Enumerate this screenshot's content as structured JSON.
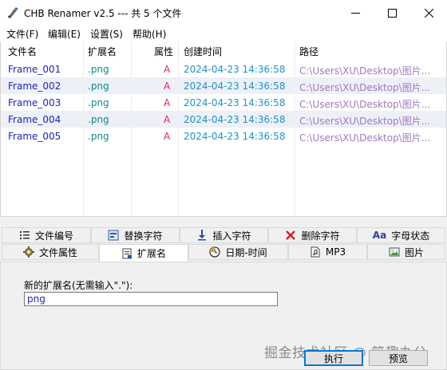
{
  "window": {
    "title": "CHB Renamer v2.5 --- 共 5 个文件"
  },
  "menu": [
    {
      "label": "文件(F)"
    },
    {
      "label": "编辑(E)"
    },
    {
      "label": "设置(S)"
    },
    {
      "label": "帮助(H)"
    }
  ],
  "list": {
    "headers": [
      "文件名",
      "扩展名",
      "属性",
      "创建时间",
      "路径"
    ],
    "rows": [
      {
        "name": "Frame_001",
        "ext": ".png",
        "attr": "A",
        "time": "2024-04-23 14:36:58",
        "path": "C:\\Users\\XU\\Desktop\\图片..."
      },
      {
        "name": "Frame_002",
        "ext": ".png",
        "attr": "A",
        "time": "2024-04-23 14:36:58",
        "path": "C:\\Users\\XU\\Desktop\\图片..."
      },
      {
        "name": "Frame_003",
        "ext": ".png",
        "attr": "A",
        "time": "2024-04-23 14:36:58",
        "path": "C:\\Users\\XU\\Desktop\\图片..."
      },
      {
        "name": "Frame_004",
        "ext": ".png",
        "attr": "A",
        "time": "2024-04-23 14:36:58",
        "path": "C:\\Users\\XU\\Desktop\\图片..."
      },
      {
        "name": "Frame_005",
        "ext": ".png",
        "attr": "A",
        "time": "2024-04-23 14:36:58",
        "path": "C:\\Users\\XU\\Desktop\\图片..."
      }
    ]
  },
  "tabs_row1": [
    {
      "label": "文件编号",
      "icon": "list-numbered-icon"
    },
    {
      "label": "替换字符",
      "icon": "replace-icon"
    },
    {
      "label": "插入字符",
      "icon": "insert-down-arrow-icon"
    },
    {
      "label": "删除字符",
      "icon": "delete-x-icon"
    },
    {
      "label": "字母状态",
      "icon": "letter-case-icon"
    }
  ],
  "tabs_row2": [
    {
      "label": "文件属性",
      "icon": "gear-icon"
    },
    {
      "label": "扩展名",
      "icon": "extension-icon"
    },
    {
      "label": "日期-时间",
      "icon": "clock-icon"
    },
    {
      "label": "MP3",
      "icon": "music-file-icon"
    },
    {
      "label": "图片",
      "icon": "picture-icon"
    }
  ],
  "active_tab": "扩展名",
  "extension_panel": {
    "label": "新的扩展名(无需输入\".\"):",
    "value": "png"
  },
  "buttons": {
    "execute": "执行",
    "preview": "预览"
  },
  "watermark": "掘金技术社区 @ 简趣办公",
  "colors": {
    "name": "#1c23c5",
    "ext": "#0a8a8a",
    "attr": "#e0216a",
    "time": "#1a96c7",
    "path": "#a079c0",
    "alt_row": "#eef0f8"
  }
}
